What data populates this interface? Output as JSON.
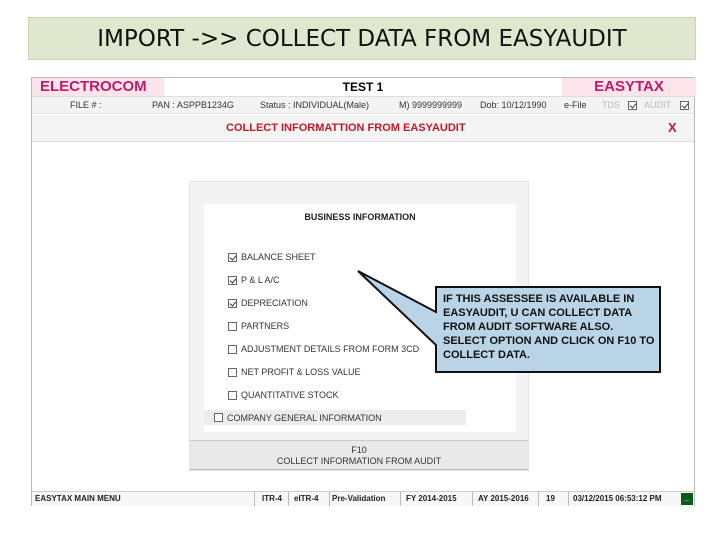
{
  "slide": {
    "title": "IMPORT ->> COLLECT DATA FROM EASYAUDIT"
  },
  "app": {
    "brand_left": "ELECTROCOM",
    "brand_center": "TEST 1",
    "brand_right": "EASYTAX",
    "info": {
      "file": "FILE # :",
      "pan": "PAN : ASPPB1234G",
      "status": "Status : INDIVIDUAL(Male)",
      "mobile": "M) 9999999999",
      "dob": "Dob: 10/12/1990",
      "efile": "e-File",
      "tds": "TDS",
      "audit": "AUDIT"
    },
    "panel": {
      "title": "COLLECT INFORMATTION FROM EASYAUDIT",
      "close": "X"
    },
    "business": {
      "heading": "BUSINESS INFORMATION",
      "options": [
        {
          "label": "BALANCE SHEET",
          "checked": true
        },
        {
          "label": "P & L A/C",
          "checked": true
        },
        {
          "label": "DEPRECIATION",
          "checked": true
        },
        {
          "label": "PARTNERS",
          "checked": false
        },
        {
          "label": "ADJUSTMENT DETAILS FROM FORM 3CD",
          "checked": false
        },
        {
          "label": "NET PROFIT & LOSS VALUE",
          "checked": false
        },
        {
          "label": "QUANTITATIVE STOCK",
          "checked": false
        }
      ],
      "company": {
        "label": "COMPANY GENERAL INFORMATION",
        "checked": false
      }
    },
    "f10": {
      "key": "F10",
      "label": "COLLECT INFORMATION FROM AUDIT"
    },
    "status_bar": {
      "menu": "EASYTAX MAIN MENU",
      "itr": "ITR-4",
      "eitr": "eITR-4",
      "prevalidation": "Pre-Validation",
      "fy": "FY 2014-2015",
      "ay": "AY 2015-2016",
      "count": "19",
      "datetime": "03/12/2015 06:53:12 PM",
      "minimize": "_"
    }
  },
  "callout": {
    "text": "IF THIS ASSESSEE IS AVAILABLE IN EASYAUDIT, U CAN COLLECT DATA FROM AUDIT SOFTWARE ALSO. SELECT OPTION AND CLICK ON F10 TO COLLECT DATA.",
    "fill": "#b9d4e6",
    "border": "#111111"
  }
}
